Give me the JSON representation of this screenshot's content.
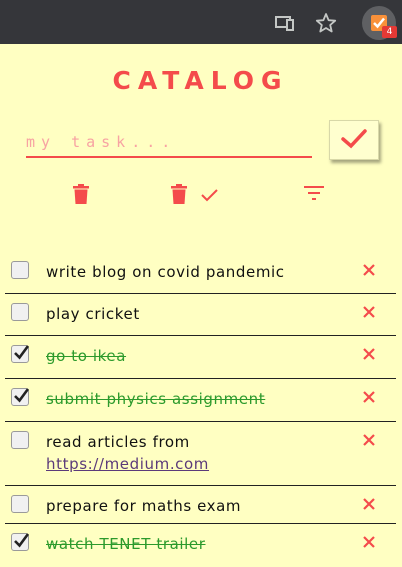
{
  "browser": {
    "extension": {
      "badge": "4"
    }
  },
  "app": {
    "title": "CATALOG",
    "input": {
      "placeholder": "my task...",
      "value": ""
    },
    "colors": {
      "accent": "#f44b4b",
      "background": "#ffffc2",
      "done": "#2c9a2c"
    }
  },
  "tasks": [
    {
      "text": "write blog on covid pandemic",
      "done": false
    },
    {
      "text": "play cricket",
      "done": false
    },
    {
      "text": "go to ikea",
      "done": true
    },
    {
      "text": "submit physics assignment",
      "done": true
    },
    {
      "text": "read articles from",
      "link": "https://medium.com",
      "done": false
    },
    {
      "text": "prepare for maths exam",
      "done": false
    },
    {
      "text": "watch TENET trailer",
      "done": true
    }
  ]
}
